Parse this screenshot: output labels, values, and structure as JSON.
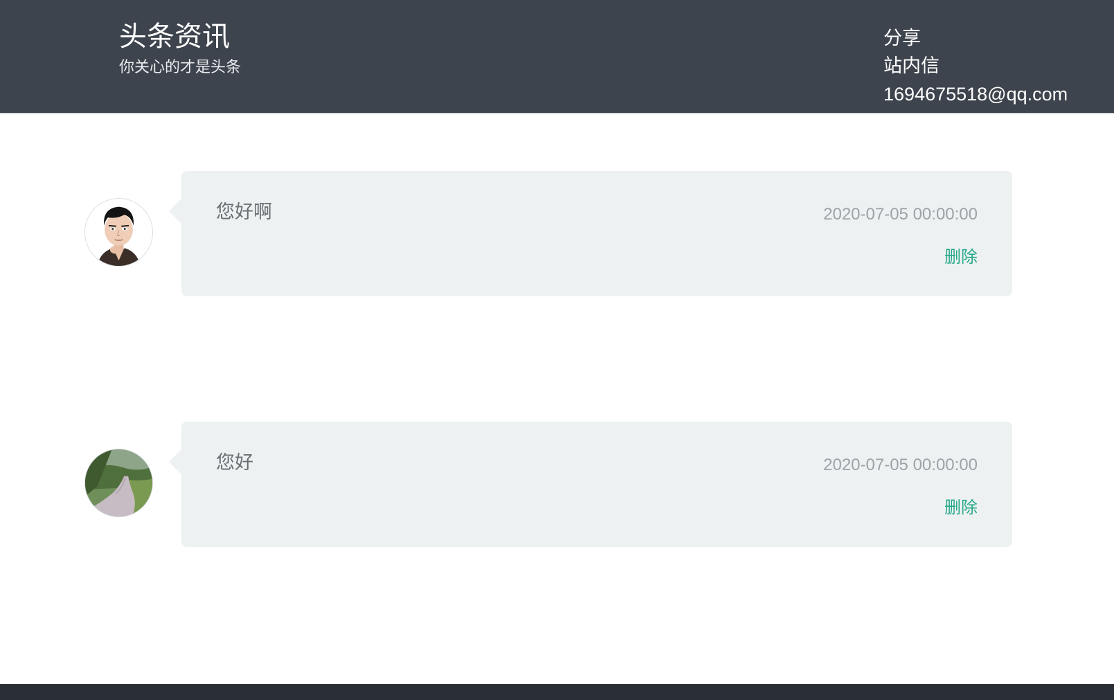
{
  "header": {
    "title": "头条资讯",
    "subtitle": "你关心的才是头条",
    "nav": [
      {
        "label": "分享"
      },
      {
        "label": "站内信"
      },
      {
        "label": "1694675518@qq.com"
      }
    ]
  },
  "messages": [
    {
      "text": "您好啊",
      "time": "2020-07-05 00:00:00",
      "delete_label": "删除",
      "avatar": "cartoon-man-avatar"
    },
    {
      "text": "您好",
      "time": "2020-07-05 00:00:00",
      "delete_label": "删除",
      "avatar": "country-road-avatar"
    }
  ],
  "colors": {
    "header_bg": "#3e444d",
    "bubble_bg": "#edf1f2",
    "delete_link": "#27a88a",
    "footer_bg": "#2a2f35"
  }
}
